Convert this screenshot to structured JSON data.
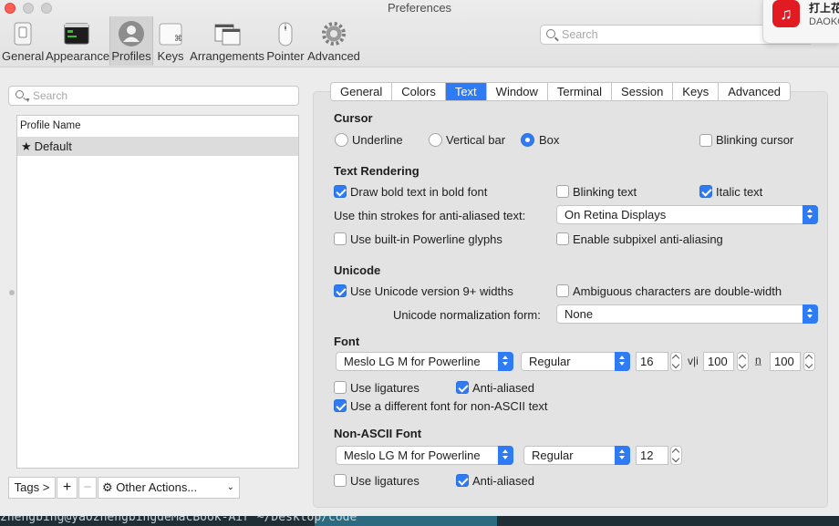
{
  "window": {
    "title": "Preferences"
  },
  "toolbar": {
    "items": [
      {
        "label": "General",
        "icon": "general-switch-icon"
      },
      {
        "label": "Appearance",
        "icon": "appearance-terminal-icon"
      },
      {
        "label": "Profiles",
        "icon": "profiles-person-icon"
      },
      {
        "label": "Keys",
        "icon": "keys-command-icon"
      },
      {
        "label": "Arrangements",
        "icon": "arrangements-windows-icon"
      },
      {
        "label": "Pointer",
        "icon": "pointer-mouse-icon"
      },
      {
        "label": "Advanced",
        "icon": "advanced-gear-icon"
      }
    ],
    "active": "Profiles",
    "search_placeholder": "Search"
  },
  "notification": {
    "title": "打上花",
    "subtitle": "DAOKO",
    "app_icon": "netease-music-icon"
  },
  "profiles": {
    "search_placeholder": "Search",
    "column_header": "Profile Name",
    "rows": [
      {
        "name": "Default",
        "is_default": true
      }
    ],
    "tags_button": "Tags >",
    "add_button": "+",
    "remove_button": "−",
    "other_actions": "Other Actions..."
  },
  "tabs": {
    "items": [
      "General",
      "Colors",
      "Text",
      "Window",
      "Terminal",
      "Session",
      "Keys",
      "Advanced"
    ],
    "active": "Text"
  },
  "cursor": {
    "title": "Cursor",
    "underline": "Underline",
    "vertical_bar": "Vertical bar",
    "box": "Box",
    "selected": "Box",
    "blinking_cursor": "Blinking cursor",
    "blinking_cursor_checked": false
  },
  "text_rendering": {
    "title": "Text Rendering",
    "draw_bold": "Draw bold text in bold font",
    "draw_bold_checked": true,
    "blinking_text": "Blinking text",
    "blinking_text_checked": false,
    "italic_text": "Italic text",
    "italic_text_checked": true,
    "thin_strokes_label": "Use thin strokes for anti-aliased text:",
    "thin_strokes_value": "On Retina Displays",
    "powerline": "Use built-in Powerline glyphs",
    "powerline_checked": false,
    "subpixel": "Enable subpixel anti-aliasing",
    "subpixel_checked": false
  },
  "unicode": {
    "title": "Unicode",
    "version9": "Use Unicode version 9+ widths",
    "version9_checked": true,
    "ambiguous": "Ambiguous characters are double-width",
    "ambiguous_checked": false,
    "normalization_label": "Unicode normalization form:",
    "normalization_value": "None"
  },
  "font": {
    "title": "Font",
    "family": "Meslo LG M for Powerline",
    "style": "Regular",
    "size": "16",
    "v_spacing_icon": "v|i",
    "v_spacing": "100",
    "h_spacing_icon": "n̲",
    "h_spacing": "100",
    "ligatures": "Use ligatures",
    "ligatures_checked": false,
    "anti_aliased": "Anti-aliased",
    "anti_aliased_checked": true,
    "non_ascii_diff": "Use a different font for non-ASCII text",
    "non_ascii_diff_checked": true
  },
  "non_ascii_font": {
    "title": "Non-ASCII Font",
    "family": "Meslo LG M for Powerline",
    "style": "Regular",
    "size": "12",
    "ligatures": "Use ligatures",
    "ligatures_checked": false,
    "anti_aliased": "Anti-aliased",
    "anti_aliased_checked": true
  },
  "terminal_strip": {
    "prompt": "zhengbing@yaozhengbingdeMacBook-Air  ~/Desktop/code"
  },
  "colors": {
    "accent": "#2f7bf5",
    "close": "#ff5f57",
    "notification_icon": "#e21b22"
  }
}
